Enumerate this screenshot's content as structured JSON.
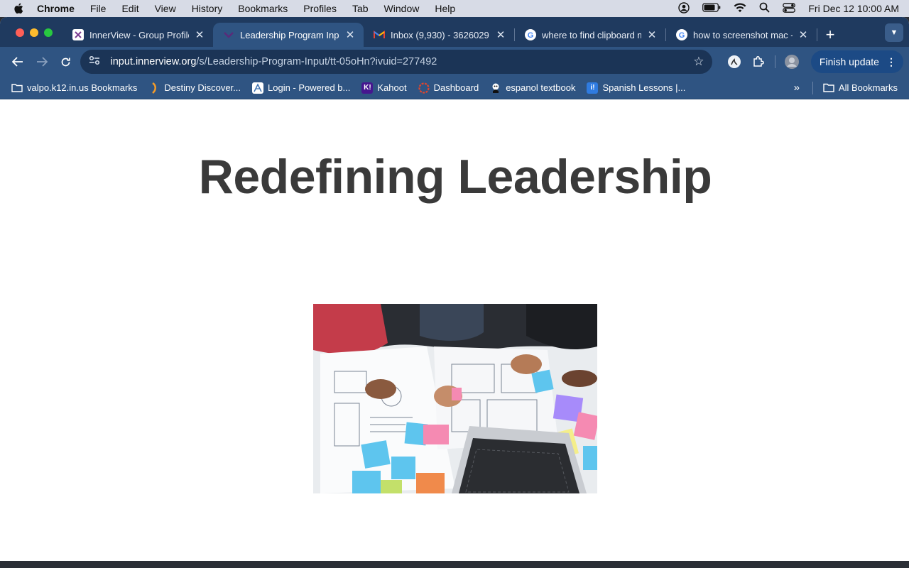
{
  "menubar": {
    "app_name": "Chrome",
    "items": [
      "File",
      "Edit",
      "View",
      "History",
      "Bookmarks",
      "Profiles",
      "Tab",
      "Window",
      "Help"
    ],
    "clock": "Fri Dec 12  10:00 AM"
  },
  "tabs": [
    {
      "title": "InnerView - Group Profile",
      "icon": "innerview-icon",
      "active": false
    },
    {
      "title": "Leadership Program Input",
      "icon": "innerview-icon",
      "active": true
    },
    {
      "title": "Inbox (9,930) - 3626029",
      "icon": "gmail-icon",
      "active": false
    },
    {
      "title": "where to find clipboard m",
      "icon": "google-icon",
      "active": false
    },
    {
      "title": "how to screenshot mac -",
      "icon": "google-icon",
      "active": false
    }
  ],
  "toolbar": {
    "url_host": "input.innerview.org",
    "url_path": "/s/Leadership-Program-Input/tt-05oHn?ivuid=277492",
    "update_label": "Finish update"
  },
  "bookmarks": {
    "items": [
      {
        "label": "valpo.k12.in.us Bookmarks",
        "icon": "folder-link-icon"
      },
      {
        "label": "Destiny Discover...",
        "icon": "destiny-icon"
      },
      {
        "label": "Login - Powered b...",
        "icon": "login-icon"
      },
      {
        "label": "Kahoot",
        "icon": "kahoot-icon"
      },
      {
        "label": "Dashboard",
        "icon": "dashboard-icon"
      },
      {
        "label": "espanol textbook",
        "icon": "textbook-icon"
      },
      {
        "label": "Spanish Lessons |...",
        "icon": "lessons-icon"
      }
    ],
    "all_label": "All Bookmarks"
  },
  "page": {
    "title": "Redefining Leadership"
  },
  "colors": {
    "tabstrip": "#1f3a5f",
    "toolbar": "#2f5482",
    "title_text": "#3a3a3a"
  }
}
